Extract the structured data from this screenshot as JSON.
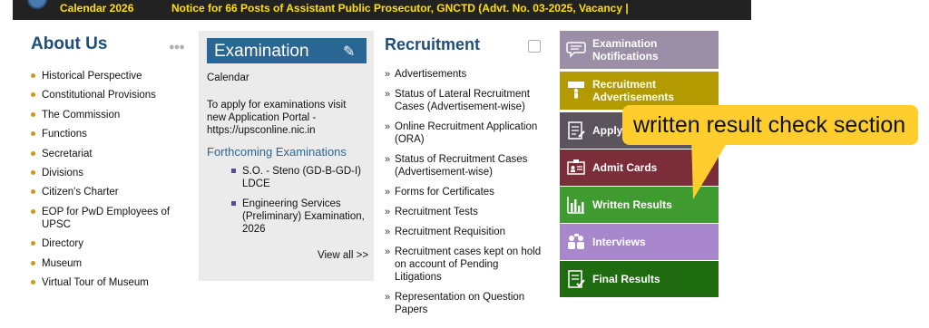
{
  "ticker": {
    "items": [
      "Calendar 2026",
      "Notice for 66 Posts of Assistant Public Prosecutor, GNCTD (Advt. No. 03-2025, Vacancy |"
    ]
  },
  "about": {
    "title": "About Us",
    "icon": "people-icon",
    "items": [
      "Historical Perspective",
      "Constitutional Provisions",
      "The Commission",
      "Functions",
      "Secretariat",
      "Divisions",
      "Citizen's Charter",
      "EOP for PwD Employees of UPSC",
      "Directory",
      "Museum",
      "Virtual Tour of Museum"
    ]
  },
  "examination": {
    "title": "Examination",
    "calendar": "Calendar",
    "apply_text": "To apply for examinations visit new Application Portal - https://upsconline.nic.in",
    "forthcoming": "Forthcoming Examinations",
    "items": [
      "S.O. - Steno (GD-B-GD-I) LDCE",
      "Engineering Services (Preliminary) Examination, 2026"
    ],
    "view_all": "View all >>"
  },
  "recruitment": {
    "title": "Recruitment",
    "items": [
      "Advertisements",
      "Status of Lateral Recruitment Cases (Advertisement-wise)",
      "Online Recruitment Application (ORA)",
      "Status of Recruitment Cases (Advertisement-wise)",
      "Forms for Certificates",
      "Recruitment Tests",
      "Recruitment Requisition",
      "Recruitment cases kept on hold on account of Pending Litigations",
      "Representation on Question Papers"
    ]
  },
  "tiles": [
    {
      "label": "Examination Notifications",
      "color": "#9a8fa6",
      "icon": "chat-icon"
    },
    {
      "label": "Recruitment Advertisements",
      "color": "#b39a00",
      "icon": "person-sign-icon"
    },
    {
      "label": "Apply",
      "color": "#5b535e",
      "icon": "form-icon"
    },
    {
      "label": "Admit Cards",
      "color": "#7b2d3a",
      "icon": "id-card-icon"
    },
    {
      "label": "Written Results",
      "color": "#3f9b2f",
      "icon": "bar-chart-icon"
    },
    {
      "label": "Interviews",
      "color": "#a987cc",
      "icon": "interview-icon"
    },
    {
      "label": "Final Results",
      "color": "#1e6b10",
      "icon": "checklist-icon"
    }
  ],
  "callout": {
    "text": "written result check section",
    "color": "#ffce2e"
  }
}
